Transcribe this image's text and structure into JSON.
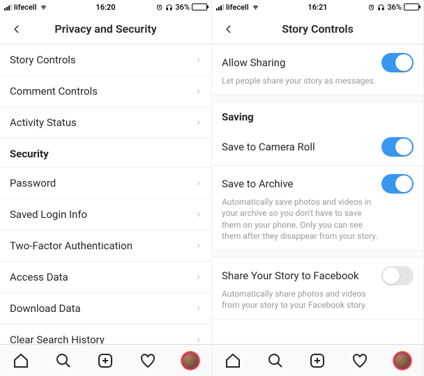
{
  "left": {
    "status": {
      "carrier": "lifecell",
      "time": "16:20",
      "battery": "36%"
    },
    "header": {
      "title": "Privacy and Security"
    },
    "rows": [
      "Story Controls",
      "Comment Controls",
      "Activity Status"
    ],
    "section": "Security",
    "rows2": [
      "Password",
      "Saved Login Info",
      "Two-Factor Authentication",
      "Access Data",
      "Download Data",
      "Clear Search History"
    ]
  },
  "right": {
    "status": {
      "carrier": "lifecell",
      "time": "16:21",
      "battery": "36%"
    },
    "header": {
      "title": "Story Controls"
    },
    "allow_sharing": {
      "title": "Allow Sharing",
      "sub": "Let people share your story as messages.",
      "on": true
    },
    "saving_header": "Saving",
    "save_camera": {
      "title": "Save to Camera Roll",
      "on": true
    },
    "save_archive": {
      "title": "Save to Archive",
      "sub": "Automatically save photos and videos in your archive so you don't have to save them on your phone. Only you can see them after they disappear from your story.",
      "on": true
    },
    "share_fb": {
      "title": "Share Your Story to Facebook",
      "sub": "Automatically share photos and videos from your story to your Facebook story.",
      "on": false
    }
  },
  "icons": {
    "wifi": "wifi",
    "alarm": "alarm",
    "headphones": "headphones"
  }
}
